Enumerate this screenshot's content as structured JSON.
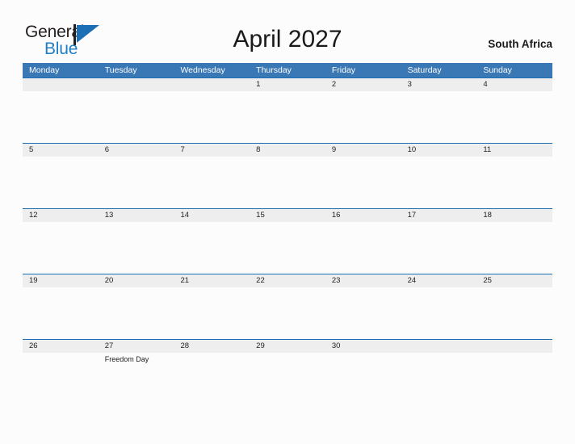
{
  "brand": {
    "name_part1": "General",
    "name_part2": "Blue",
    "triangle_icon": "triangle-icon",
    "accent_color": "#1c6fb5",
    "text_color": "#231f20"
  },
  "header": {
    "title": "April 2027",
    "region": "South Africa"
  },
  "calendar": {
    "header_bg": "#3a77b5",
    "band_bg": "#eeeeee",
    "rule_color": "#1c6fb5",
    "day_names": [
      "Monday",
      "Tuesday",
      "Wednesday",
      "Thursday",
      "Friday",
      "Saturday",
      "Sunday"
    ],
    "weeks": [
      {
        "days": [
          {
            "date": "",
            "event": ""
          },
          {
            "date": "",
            "event": ""
          },
          {
            "date": "",
            "event": ""
          },
          {
            "date": "1",
            "event": ""
          },
          {
            "date": "2",
            "event": ""
          },
          {
            "date": "3",
            "event": ""
          },
          {
            "date": "4",
            "event": ""
          }
        ]
      },
      {
        "days": [
          {
            "date": "5",
            "event": ""
          },
          {
            "date": "6",
            "event": ""
          },
          {
            "date": "7",
            "event": ""
          },
          {
            "date": "8",
            "event": ""
          },
          {
            "date": "9",
            "event": ""
          },
          {
            "date": "10",
            "event": ""
          },
          {
            "date": "11",
            "event": ""
          }
        ]
      },
      {
        "days": [
          {
            "date": "12",
            "event": ""
          },
          {
            "date": "13",
            "event": ""
          },
          {
            "date": "14",
            "event": ""
          },
          {
            "date": "15",
            "event": ""
          },
          {
            "date": "16",
            "event": ""
          },
          {
            "date": "17",
            "event": ""
          },
          {
            "date": "18",
            "event": ""
          }
        ]
      },
      {
        "days": [
          {
            "date": "19",
            "event": ""
          },
          {
            "date": "20",
            "event": ""
          },
          {
            "date": "21",
            "event": ""
          },
          {
            "date": "22",
            "event": ""
          },
          {
            "date": "23",
            "event": ""
          },
          {
            "date": "24",
            "event": ""
          },
          {
            "date": "25",
            "event": ""
          }
        ]
      },
      {
        "days": [
          {
            "date": "26",
            "event": ""
          },
          {
            "date": "27",
            "event": "Freedom Day"
          },
          {
            "date": "28",
            "event": ""
          },
          {
            "date": "29",
            "event": ""
          },
          {
            "date": "30",
            "event": ""
          },
          {
            "date": "",
            "event": ""
          },
          {
            "date": "",
            "event": ""
          }
        ]
      }
    ]
  }
}
